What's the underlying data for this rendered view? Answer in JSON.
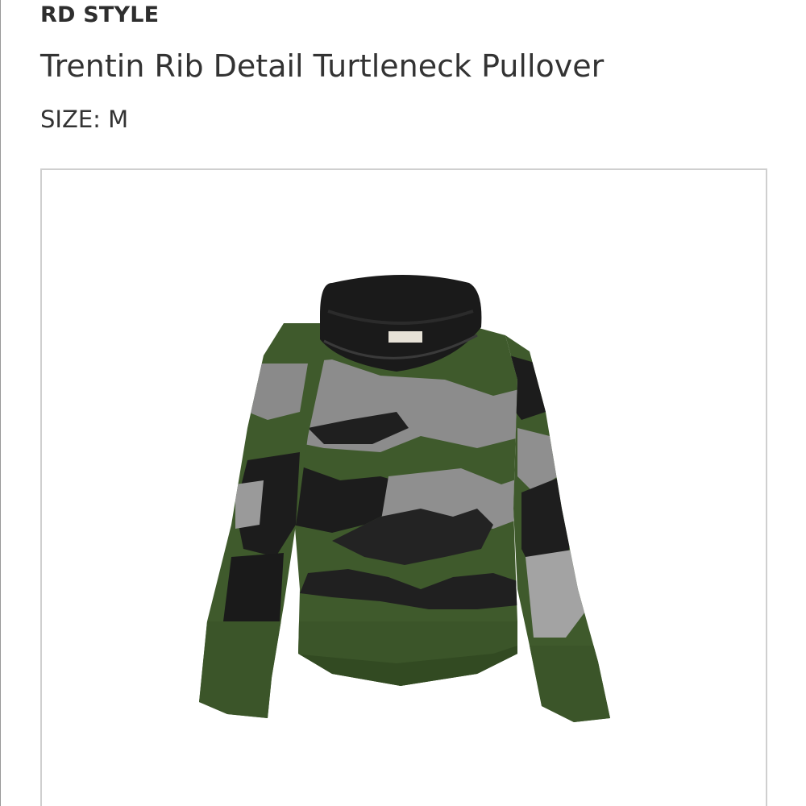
{
  "product": {
    "brand": "RD STYLE",
    "name": "Trentin Rib Detail Turtleneck Pullover",
    "size_label": "SIZE:",
    "size_value": "M"
  },
  "image": {
    "subject": "sweater-photo",
    "colors": {
      "green": "#3f5a2c",
      "dark_green": "#2f4520",
      "black": "#1c1c1c",
      "gray": "#8a8a8a",
      "light_gray": "#a5a5a5"
    }
  }
}
